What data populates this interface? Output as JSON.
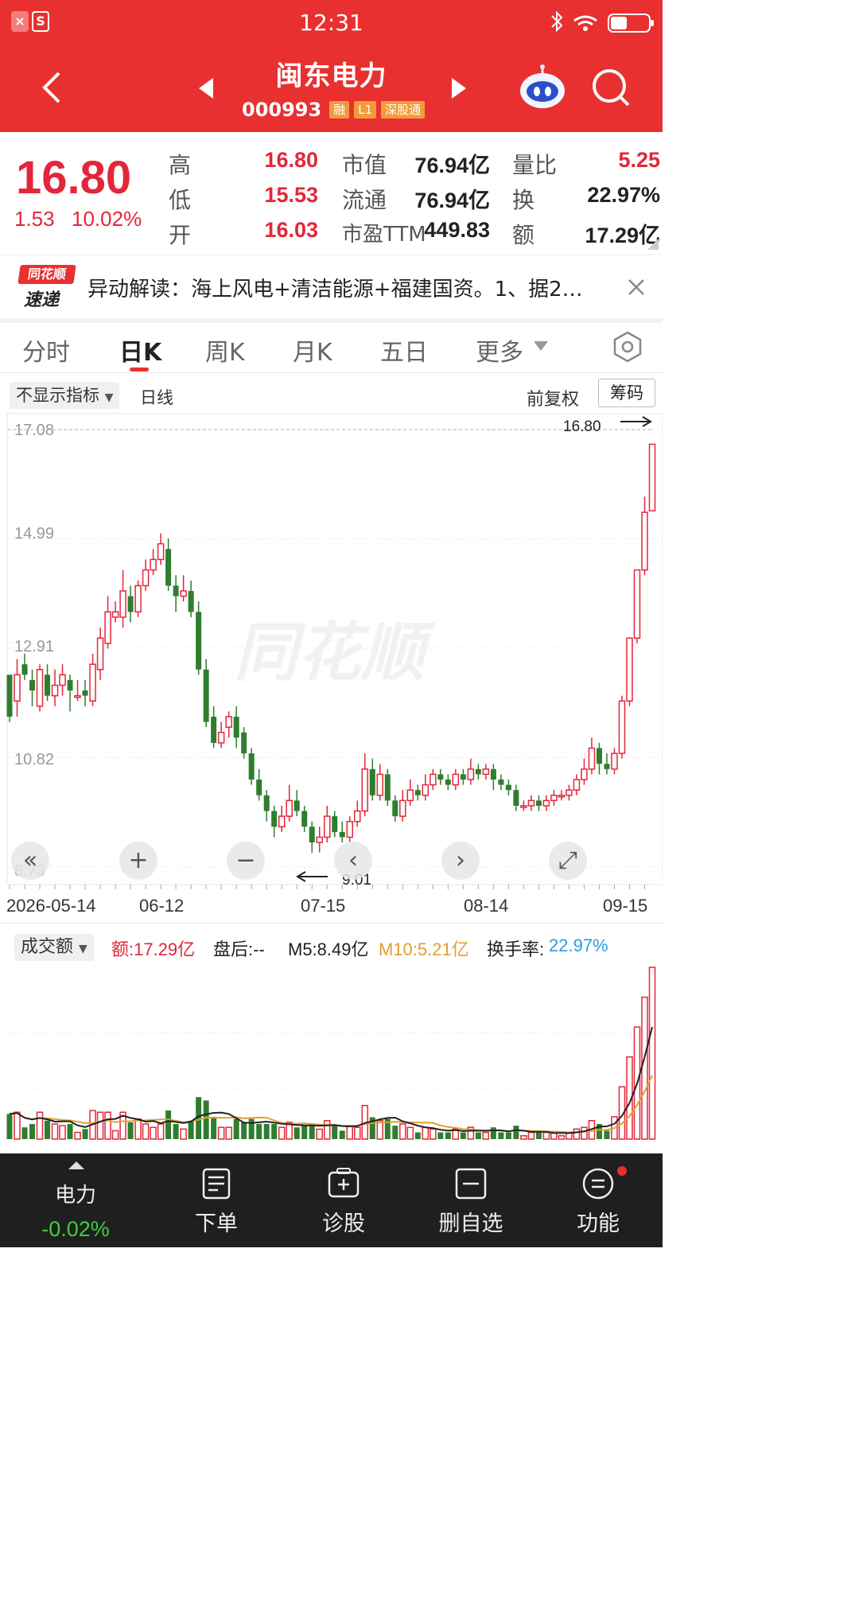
{
  "status": {
    "time": "12:31",
    "app_icons": [
      "×",
      "S"
    ]
  },
  "header": {
    "title": "闽东电力",
    "code": "000993",
    "tags": [
      "融",
      "L1",
      "深股通"
    ]
  },
  "quote": {
    "price": "16.80",
    "change": "1.53",
    "change_pct": "10.02%",
    "rows": [
      {
        "l1": "高",
        "v1": "16.80",
        "l2": "市值",
        "v2": "76.94亿",
        "l3": "量比",
        "v3": "5.25"
      },
      {
        "l1": "低",
        "v1": "15.53",
        "l2": "流通",
        "v2": "76.94亿",
        "l3": "换",
        "v3": "22.97%"
      },
      {
        "l1": "开",
        "v1": "16.03",
        "l2": "市盈TTM",
        "v2": "449.83",
        "l3": "额",
        "v3": "17.29亿"
      }
    ]
  },
  "news": {
    "badge_top": "同花顺",
    "badge_bottom": "速递",
    "text": "异动解读：海上风电+清洁能源+福建国资。1、据2…"
  },
  "tabs": [
    "分时",
    "日K",
    "周K",
    "月K",
    "五日",
    "更多"
  ],
  "toolbar": {
    "indicator": "不显示指标",
    "line_type": "日线",
    "adjust": "前复权",
    "chips": "筹码"
  },
  "watermark": "同花顺",
  "chart_data": {
    "type": "candlestick",
    "y_ticks": [
      "17.08",
      "14.99",
      "12.91",
      "10.82",
      "8.73"
    ],
    "x_ticks": [
      "2026-05-14",
      "06-12",
      "07-15",
      "08-14",
      "09-15"
    ],
    "high_marker": "16.80",
    "low_marker": "9.01",
    "ylim": [
      8.73,
      17.08
    ],
    "candles": [
      [
        12.4,
        11.6,
        12.2,
        11.5
      ],
      [
        11.9,
        12.4,
        12.7,
        11.6
      ],
      [
        12.6,
        12.4,
        12.8,
        12.3
      ],
      [
        12.3,
        12.1,
        12.5,
        11.8
      ],
      [
        11.8,
        12.5,
        12.6,
        11.7
      ],
      [
        12.4,
        12.0,
        12.6,
        11.9
      ],
      [
        12.0,
        12.2,
        12.5,
        11.8
      ],
      [
        12.2,
        12.4,
        12.6,
        12.0
      ],
      [
        12.3,
        12.1,
        12.4,
        11.7
      ],
      [
        12.0,
        12.0,
        12.3,
        11.9
      ],
      [
        12.1,
        12.0,
        12.3,
        11.8
      ],
      [
        11.9,
        12.6,
        12.8,
        11.8
      ],
      [
        12.5,
        13.1,
        13.3,
        12.3
      ],
      [
        13.0,
        13.6,
        13.9,
        12.9
      ],
      [
        13.5,
        13.6,
        13.8,
        13.4
      ],
      [
        13.5,
        14.0,
        14.4,
        13.3
      ],
      [
        13.9,
        13.6,
        14.1,
        13.4
      ],
      [
        13.6,
        14.1,
        14.2,
        13.5
      ],
      [
        14.1,
        14.4,
        14.6,
        14.0
      ],
      [
        14.4,
        14.6,
        14.8,
        14.3
      ],
      [
        14.6,
        14.9,
        15.1,
        14.5
      ],
      [
        14.8,
        14.1,
        15.0,
        14.0
      ],
      [
        14.1,
        13.9,
        14.3,
        13.6
      ],
      [
        13.9,
        14.0,
        14.3,
        13.8
      ],
      [
        14.0,
        13.6,
        14.2,
        13.5
      ],
      [
        13.6,
        12.5,
        13.8,
        12.4
      ],
      [
        12.5,
        11.5,
        12.7,
        11.4
      ],
      [
        11.6,
        11.1,
        11.8,
        11.0
      ],
      [
        11.1,
        11.3,
        11.5,
        11.0
      ],
      [
        11.4,
        11.6,
        11.7,
        11.2
      ],
      [
        11.6,
        11.2,
        11.8,
        11.0
      ],
      [
        11.3,
        10.9,
        11.4,
        10.8
      ],
      [
        10.9,
        10.4,
        11.0,
        10.3
      ],
      [
        10.4,
        10.1,
        10.6,
        10.0
      ],
      [
        10.1,
        9.8,
        10.2,
        9.6
      ],
      [
        9.8,
        9.5,
        9.9,
        9.3
      ],
      [
        9.5,
        9.7,
        9.9,
        9.4
      ],
      [
        9.7,
        10.0,
        10.3,
        9.6
      ],
      [
        10.0,
        9.8,
        10.2,
        9.7
      ],
      [
        9.8,
        9.5,
        9.9,
        9.4
      ],
      [
        9.5,
        9.2,
        9.6,
        9.0
      ],
      [
        9.2,
        9.3,
        9.5,
        9.01
      ],
      [
        9.3,
        9.7,
        9.9,
        9.2
      ],
      [
        9.7,
        9.4,
        9.8,
        9.3
      ],
      [
        9.4,
        9.3,
        9.6,
        9.2
      ],
      [
        9.3,
        9.6,
        9.7,
        9.2
      ],
      [
        9.6,
        9.8,
        10.0,
        9.5
      ],
      [
        9.8,
        10.6,
        10.9,
        9.7
      ],
      [
        10.6,
        10.1,
        10.8,
        10.0
      ],
      [
        10.1,
        10.5,
        10.7,
        10.0
      ],
      [
        10.5,
        10.0,
        10.6,
        9.9
      ],
      [
        10.0,
        9.7,
        10.1,
        9.6
      ],
      [
        9.7,
        10.0,
        10.2,
        9.6
      ],
      [
        10.0,
        10.2,
        10.4,
        9.9
      ],
      [
        10.2,
        10.1,
        10.3,
        10.0
      ],
      [
        10.1,
        10.3,
        10.5,
        10.0
      ],
      [
        10.3,
        10.5,
        10.6,
        10.2
      ],
      [
        10.5,
        10.4,
        10.6,
        10.3
      ],
      [
        10.4,
        10.3,
        10.5,
        10.2
      ],
      [
        10.3,
        10.5,
        10.6,
        10.2
      ],
      [
        10.5,
        10.4,
        10.6,
        10.3
      ],
      [
        10.4,
        10.6,
        10.8,
        10.3
      ],
      [
        10.6,
        10.5,
        10.7,
        10.4
      ],
      [
        10.5,
        10.6,
        10.7,
        10.4
      ],
      [
        10.6,
        10.4,
        10.7,
        10.2
      ],
      [
        10.4,
        10.3,
        10.5,
        10.2
      ],
      [
        10.3,
        10.2,
        10.4,
        10.1
      ],
      [
        10.2,
        9.9,
        10.3,
        9.8
      ],
      [
        9.9,
        9.9,
        10.0,
        9.8
      ],
      [
        9.9,
        10.0,
        10.1,
        9.8
      ],
      [
        10.0,
        9.9,
        10.1,
        9.8
      ],
      [
        9.9,
        10.0,
        10.1,
        9.8
      ],
      [
        10.0,
        10.1,
        10.2,
        9.9
      ],
      [
        10.1,
        10.1,
        10.2,
        10.0
      ],
      [
        10.1,
        10.2,
        10.3,
        10.0
      ],
      [
        10.2,
        10.4,
        10.5,
        10.1
      ],
      [
        10.4,
        10.6,
        10.8,
        10.3
      ],
      [
        10.6,
        11.0,
        11.2,
        10.5
      ],
      [
        11.0,
        10.7,
        11.1,
        10.5
      ],
      [
        10.7,
        10.6,
        10.9,
        10.5
      ],
      [
        10.6,
        10.9,
        11.0,
        10.5
      ],
      [
        10.9,
        11.9,
        12.0,
        10.8
      ],
      [
        11.9,
        13.1,
        13.1,
        11.8
      ],
      [
        13.1,
        14.4,
        14.4,
        13.0
      ],
      [
        14.4,
        15.5,
        15.8,
        14.3
      ],
      [
        15.53,
        16.8,
        16.8,
        15.53
      ]
    ]
  },
  "chart_buttons": [
    "«",
    "+",
    "−",
    "‹",
    "›",
    "⤢"
  ],
  "volume": {
    "selector": "成交额",
    "amount": "额:17.29亿",
    "after_hours": "盘后:--",
    "m5": "M5:8.49亿",
    "m10": "M10:5.21亿",
    "turnover_label": "换手率:",
    "turnover": "22.97%",
    "colors": {
      "up": "#e3263a",
      "down": "#2f7d2f",
      "m5": "#222222",
      "m10": "#e0a030",
      "turnover": "#2a9ae0"
    }
  },
  "bottom": {
    "ticker_label": "电力",
    "ticker_change": "-0.02%",
    "items": [
      {
        "label": "下单",
        "icon": "order-icon"
      },
      {
        "label": "诊股",
        "icon": "diagnose-icon"
      },
      {
        "label": "删自选",
        "icon": "remove-watchlist-icon"
      },
      {
        "label": "功能",
        "icon": "menu-icon"
      }
    ]
  }
}
